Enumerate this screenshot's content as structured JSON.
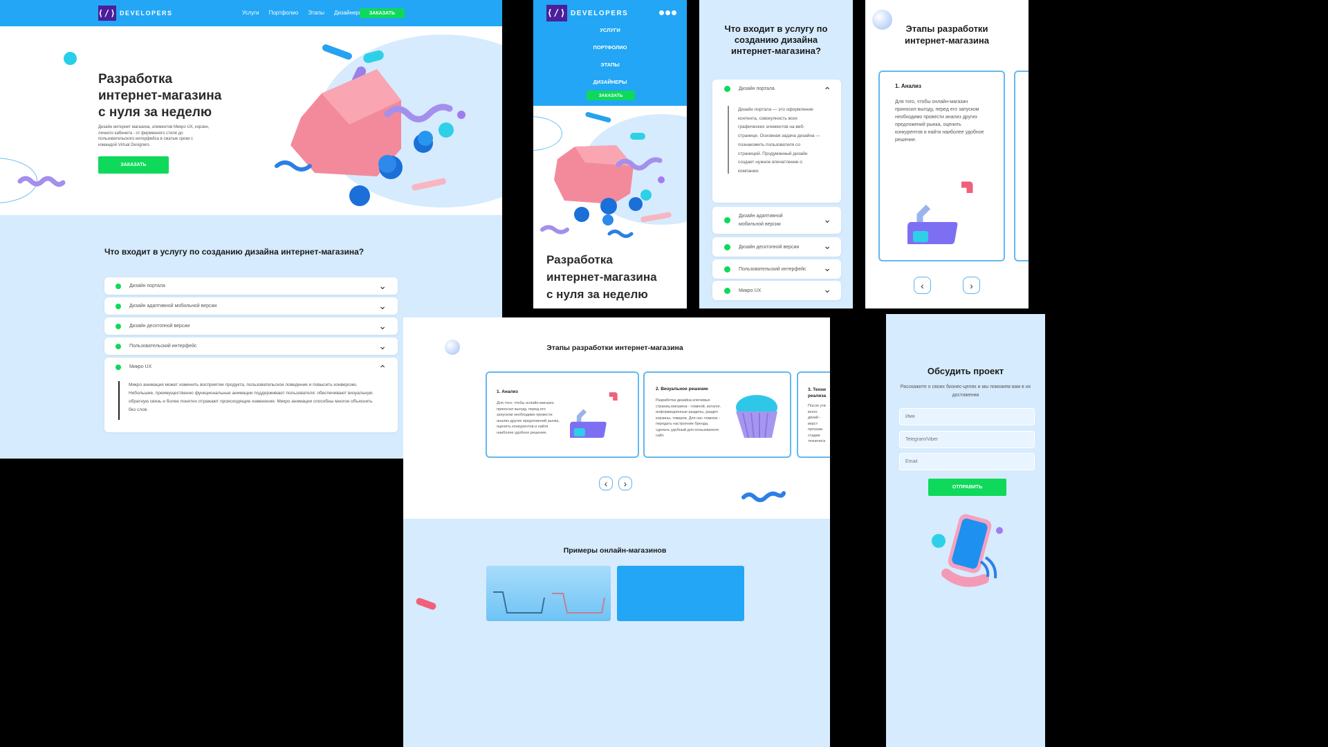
{
  "colors": {
    "brand_blue": "#22a6f5",
    "pale_blue": "#d6ebfd",
    "accent_green": "#0fd95a",
    "logo_purple": "#4b1f9a"
  },
  "brand": {
    "mark": "⟨/⟩",
    "name": "DEVELOPERS"
  },
  "nav": {
    "items": [
      "Услуги",
      "Портфолио",
      "Этапы",
      "Дизайнеры"
    ],
    "cta": "ЗАКАЗАТЬ"
  },
  "mobile_nav": {
    "items": [
      "УСЛУГИ",
      "ПОРТФОЛИО",
      "ЭТАПЫ",
      "ДИЗАЙНЕРЫ"
    ],
    "cta": "ЗАКАЗАТЬ",
    "menu_icon": "dots-menu-icon"
  },
  "hero": {
    "title_lines": [
      "Разработка",
      "интернет-магазина",
      "с нуля за неделю"
    ],
    "description": "Дизайн интернет магазина, элементов Микро UX, корзин, личного кабинета - от фирменного стиле до пользовательского интерфейса в сжатые сроки с командой Virtual Designers",
    "cta": "ЗАКАЗАТЬ"
  },
  "services": {
    "title": "Что входит в услугу по созданию дизайна интернет-магазина?",
    "title_lines": [
      "Что входит в услугу по",
      "созданию дизайна",
      "интернет-магазина?"
    ],
    "items": [
      "Дизайн портала",
      "Дизайн адаптивной мобильной версии",
      "Дизайн десктопной версии",
      "Пользовательский интерфейс",
      "Микро UX"
    ],
    "micro_ux_text": "Микро анимация может изменить восприятие продукта, пользовательское поведение и повысить конверсию. Небольшие, преимущественно функциональные анимации поддерживают пользователя: обеспечивают визуальную обратную связь и более понятно отражают происходящие изменения. Микро анимации способны многое объяснить без слов.",
    "mobile_items": [
      "Дизайн портала",
      "Дизайн адаптивной мобильной версии",
      "Дизайн десктопной версии",
      "Пользовательский интерфейс",
      "Микро UX"
    ],
    "portal_text": "Дизайн портала — это оформление контента, совокупность всех графических элементов на веб-странице. Основная задача дизайна — познакомить пользователя со страницей. Продуманный дизайн создает нужное впечатление о компании."
  },
  "stages": {
    "title": "Этапы разработки интернет-магазина",
    "mobile_title_lines": [
      "Этапы разработки",
      "интернет-магазина"
    ],
    "cards": [
      {
        "title": "1. Анализ",
        "text": "Для того, чтобы онлайн-магазин приносил выгоду, перед его запуском необходимо провести анализ других предложений рынка, оценить конкурентов и найти наиболее удобное решение."
      },
      {
        "title": "2. Визуальное решение",
        "text": "Разработка дизайна ключевых страниц магазина - главной, каталог, информационные разделы, раздел корзины, товаров. Для нас главное - передать настроение бренда, сделать удобный для пользователя сайт."
      },
      {
        "title": "3. Техни реализа",
        "text": "После утв всего дизай - верст програм стадии техническ"
      }
    ],
    "prev_icon": "chevron-left-icon",
    "next_icon": "chevron-right-icon"
  },
  "examples": {
    "title": "Примеры онлайн-магазинов"
  },
  "contact": {
    "title": "Обсудить проект",
    "subtitle": "Расскажите о своих бизнес-целях и мы поможем вам в их достижении",
    "placeholders": {
      "name": "Имя",
      "messenger": "Telegram/Viber",
      "email": "Email"
    },
    "submit": "ОТПРАВИТЬ"
  }
}
